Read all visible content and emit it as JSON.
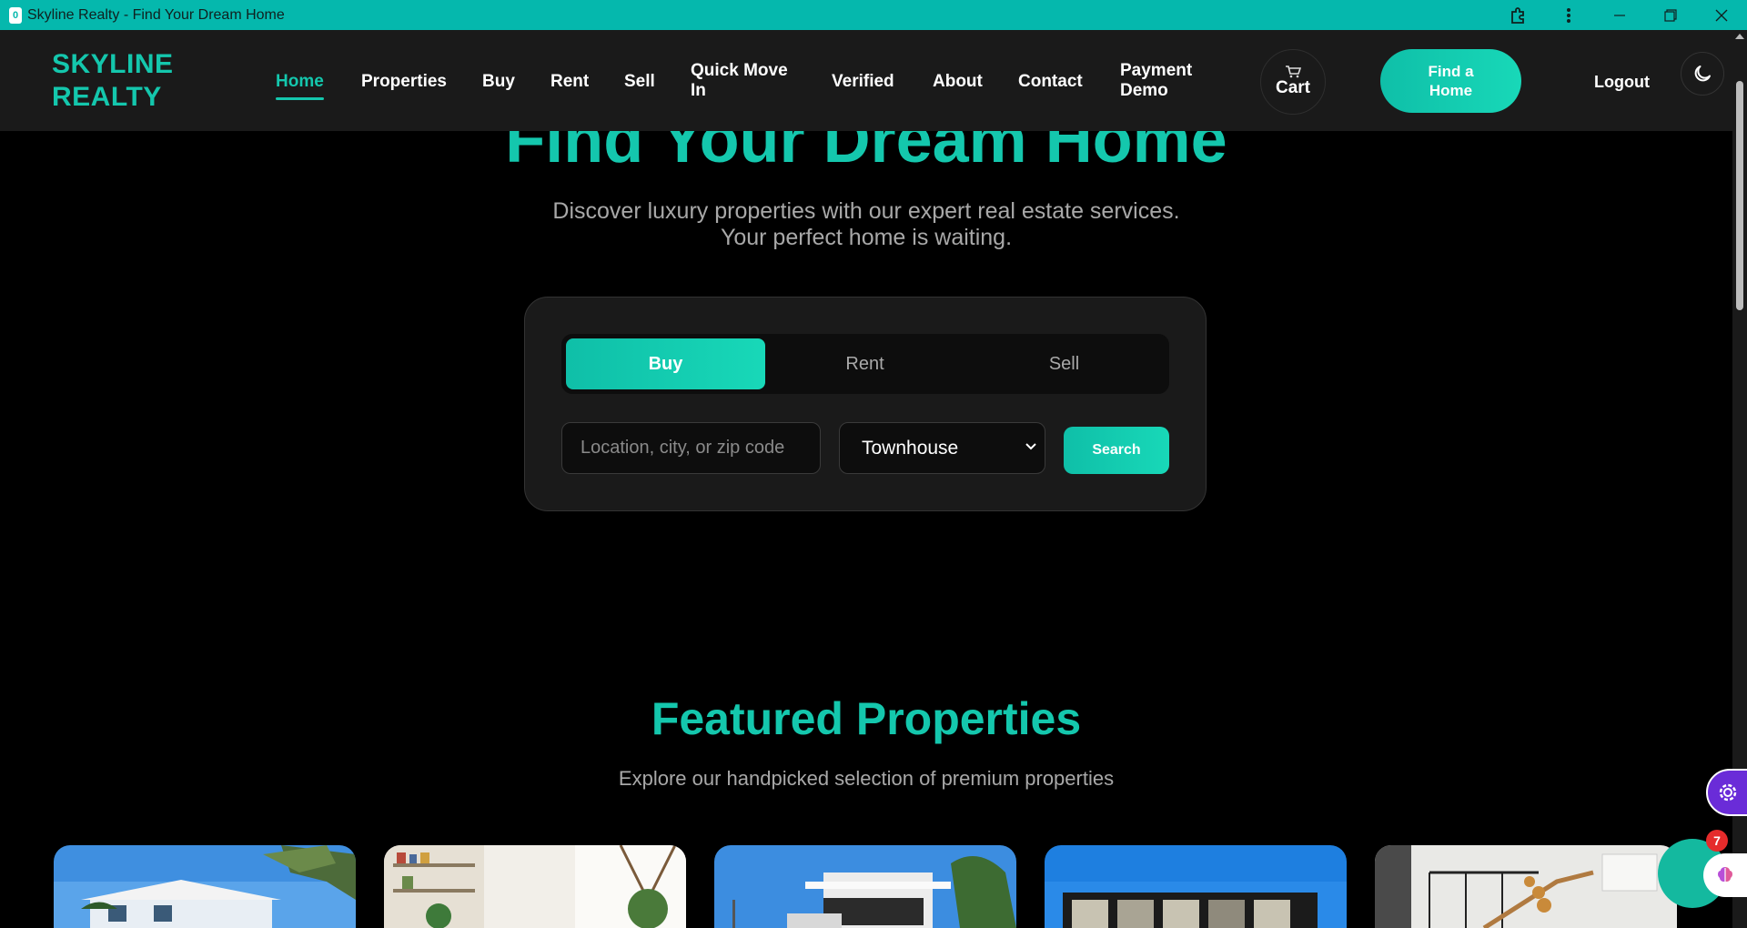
{
  "window": {
    "app_icon_letter": "0",
    "title": "Skyline Realty - Find Your Dream Home",
    "controls": [
      "extensions-icon",
      "more-icon",
      "minimize-icon",
      "restore-icon",
      "close-icon"
    ]
  },
  "navbar": {
    "brand_line1": "SKYLINE",
    "brand_line2": "REALTY",
    "items": [
      {
        "label": "Home",
        "active": true
      },
      {
        "label": "Properties"
      },
      {
        "label": "Buy"
      },
      {
        "label": "Rent"
      },
      {
        "label": "Sell"
      },
      {
        "label": "Quick Move In"
      },
      {
        "label": "Verified"
      },
      {
        "label": "About"
      },
      {
        "label": "Contact"
      },
      {
        "label": "Payment Demo"
      }
    ],
    "cart_label": "Cart",
    "find_home_label": "Find a Home",
    "logout_label": "Logout",
    "theme_icon": "moon-icon"
  },
  "hero": {
    "title": "Find Your Dream Home",
    "subtitle_line1": "Discover luxury properties with our expert real estate services.",
    "subtitle_line2": "Your perfect home is waiting."
  },
  "search": {
    "tabs": [
      {
        "label": "Buy",
        "active": true
      },
      {
        "label": "Rent"
      },
      {
        "label": "Sell"
      }
    ],
    "location_placeholder": "Location, city, or zip code",
    "location_value": "",
    "property_type_selected": "Townhouse",
    "search_label": "Search"
  },
  "featured": {
    "title": "Featured Properties",
    "subtitle": "Explore our handpicked selection of premium properties"
  },
  "widgets": {
    "chat_badge_count": "7"
  },
  "colors": {
    "accent": "#14c7ad",
    "titlebar": "#05b8ad",
    "navbar_bg": "#1a1a1a",
    "page_bg": "#000000",
    "badge": "#e52b2b",
    "settings_fab": "#6a2cd8"
  }
}
